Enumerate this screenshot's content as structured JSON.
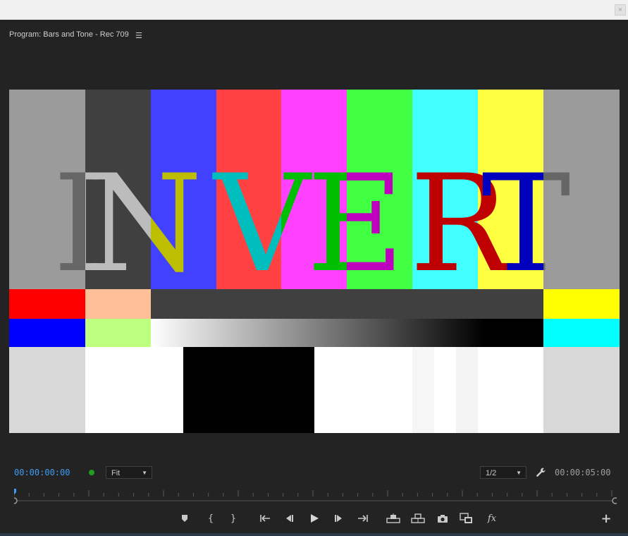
{
  "panel": {
    "title": "Program: Bars and Tone - Rec 709",
    "menu_icon": "hamburger-icon"
  },
  "viewer": {
    "overlay_text": "INVERT",
    "top_bars": [
      "#9b9b9b",
      "#404040",
      "#4141ff",
      "#ff4141",
      "#ff41ff",
      "#41ff41",
      "#41ffff",
      "#ffff41",
      "#9b9b9b"
    ],
    "text_colors": {
      "I1": "#666666",
      "I2": "#bcbcbc",
      "N1": "#bcbcbc",
      "N2": "#bebe00",
      "V1": "#00bebe",
      "V2": "#00bebe",
      "E1": "#00be00",
      "E2": "#be00be",
      "R1": "#be0000",
      "R2": "#be0000",
      "T1": "#0000be",
      "T2": "#666666"
    }
  },
  "controls": {
    "current_timecode": "00:00:00:00",
    "zoom_value": "Fit",
    "resolution_value": "1/2",
    "duration_timecode": "00:00:05:00"
  },
  "transport": {
    "buttons": [
      {
        "name": "add-marker",
        "icon": "marker-icon"
      },
      {
        "name": "mark-in",
        "icon": "mark-in-icon",
        "glyph": "{"
      },
      {
        "name": "mark-out",
        "icon": "mark-out-icon",
        "glyph": "}"
      },
      {
        "name": "go-to-in",
        "icon": "go-to-in-icon"
      },
      {
        "name": "step-back",
        "icon": "step-back-icon"
      },
      {
        "name": "play",
        "icon": "play-icon"
      },
      {
        "name": "step-forward",
        "icon": "step-forward-icon"
      },
      {
        "name": "go-to-out",
        "icon": "go-to-out-icon"
      },
      {
        "name": "lift",
        "icon": "lift-icon"
      },
      {
        "name": "extract",
        "icon": "extract-icon"
      },
      {
        "name": "export-frame",
        "icon": "camera-icon"
      },
      {
        "name": "comparison-view",
        "icon": "comparison-view-icon"
      },
      {
        "name": "global-fx-mute",
        "icon": "fx-icon",
        "glyph": "fx"
      },
      {
        "name": "button-editor",
        "icon": "plus-icon",
        "glyph": "+"
      }
    ]
  }
}
